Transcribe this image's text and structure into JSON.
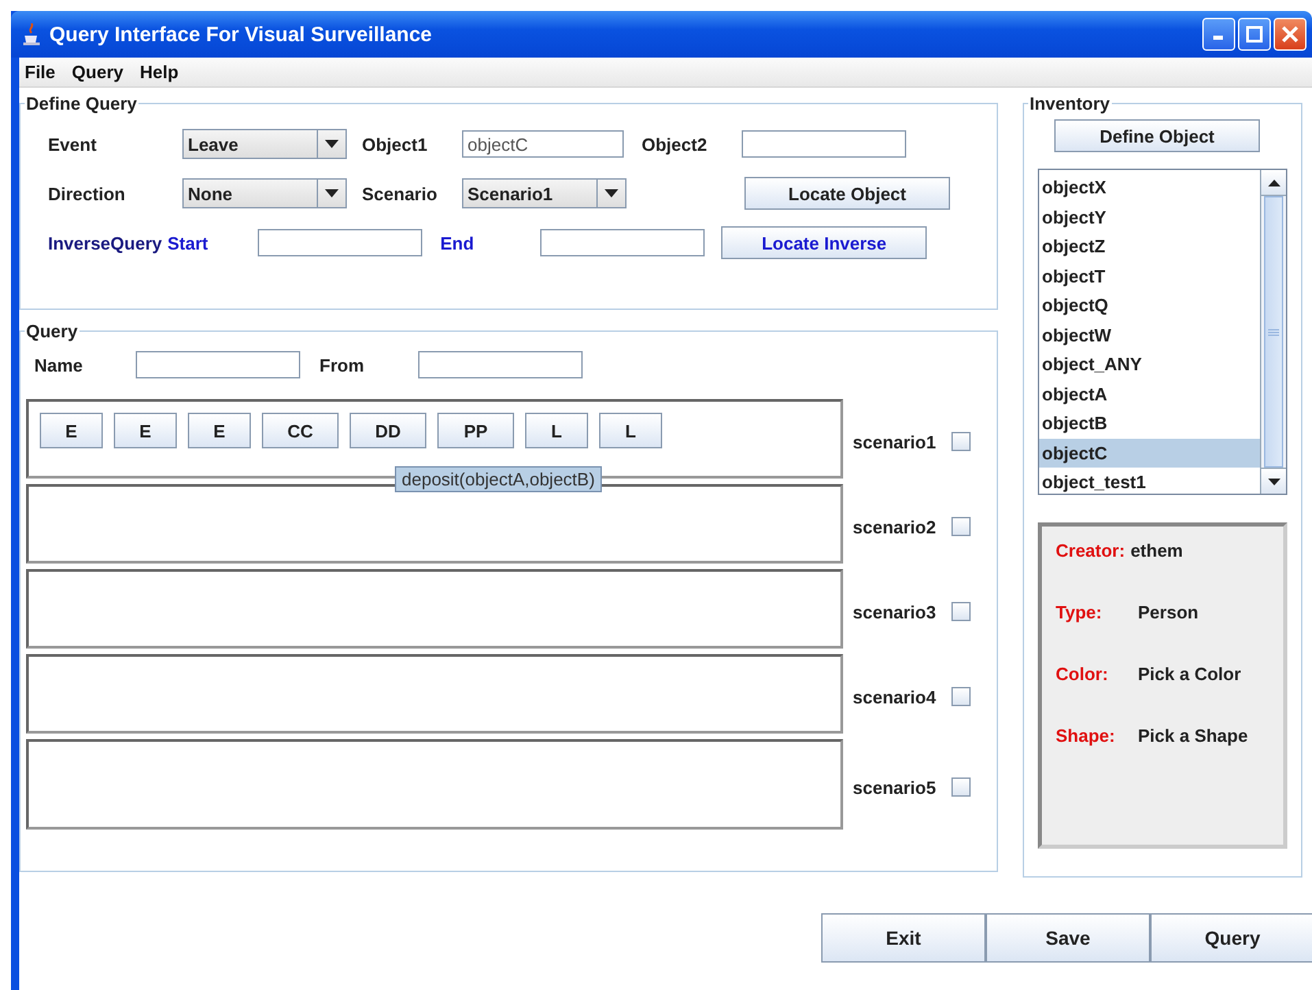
{
  "window": {
    "title": "Query Interface For Visual Surveillance"
  },
  "menu": [
    "File",
    "Query",
    "Help"
  ],
  "define_query": {
    "title": "Define Query",
    "event": {
      "label": "Event",
      "value": "Leave"
    },
    "object1": {
      "label": "Object1",
      "value": "objectC"
    },
    "object2": {
      "label": "Object2"
    },
    "direction": {
      "label": "Direction",
      "value": "None"
    },
    "scenario": {
      "label": "Scenario",
      "value": "Scenario1"
    },
    "locate_object": "Locate Object",
    "inverse_label": "InverseQuery",
    "start": {
      "label": "Start"
    },
    "end": {
      "label": "End"
    },
    "locate_inverse": "Locate Inverse"
  },
  "query": {
    "title": "Query",
    "name": {
      "label": "Name"
    },
    "from": {
      "label": "From"
    },
    "scenarios": [
      {
        "label": "scenario1",
        "checked": false,
        "events": [
          "E",
          "E",
          "E",
          "CC",
          "DD",
          "PP",
          "L",
          "L"
        ]
      },
      {
        "label": "scenario2",
        "checked": false
      },
      {
        "label": "scenario3",
        "checked": false
      },
      {
        "label": "scenario4",
        "checked": false
      },
      {
        "label": "scenario5",
        "checked": false
      }
    ],
    "tooltip": "deposit(objectA,objectB)"
  },
  "inventory": {
    "title": "Inventory",
    "define_button": "Define Object",
    "items": [
      {
        "label": "objectX",
        "selected": false
      },
      {
        "label": "objectY",
        "selected": false
      },
      {
        "label": "objectZ",
        "selected": false
      },
      {
        "label": "objectT",
        "selected": false
      },
      {
        "label": "objectQ",
        "selected": false
      },
      {
        "label": "objectW",
        "selected": false
      },
      {
        "label": "object_ANY",
        "selected": false
      },
      {
        "label": "objectA",
        "selected": false
      },
      {
        "label": "objectB",
        "selected": false
      },
      {
        "label": "objectC",
        "selected": true
      },
      {
        "label": "object_test1",
        "selected": false
      }
    ],
    "details": [
      {
        "label": "Creator:",
        "value": "ethem"
      },
      {
        "label": "Type:",
        "value": "Person"
      },
      {
        "label": "Color:",
        "value": "Pick a Color"
      },
      {
        "label": "Shape:",
        "value": "Pick a Shape"
      }
    ]
  },
  "buttons": [
    "Exit",
    "Save",
    "Query"
  ]
}
